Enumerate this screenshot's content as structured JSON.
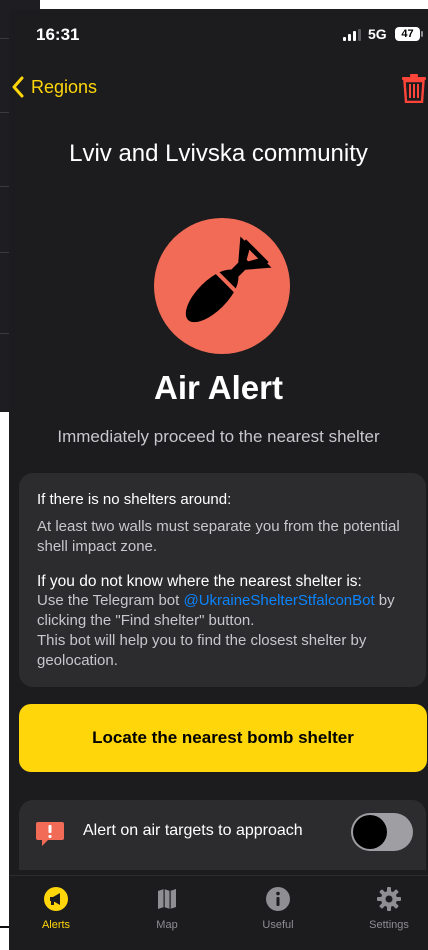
{
  "status": {
    "time": "16:31",
    "network": "5G",
    "battery": "47"
  },
  "nav": {
    "back_label": "Regions",
    "back_icon": "chevron-left-icon",
    "trash_icon": "trash-icon"
  },
  "region": {
    "title": "Lviv and Lvivska community"
  },
  "alert": {
    "icon": "bomb-icon",
    "title": "Air Alert",
    "subtitle": "Immediately proceed to the nearest shelter"
  },
  "info": {
    "no_shelters_heading": "If there is no shelters around:",
    "no_shelters_text": "At least two walls must separate you from the potential shell impact zone.",
    "unknown_heading": "If you do not know where the nearest shelter is:",
    "unknown_text_pre": "Use the Telegram bot ",
    "bot_name": "@UkraineShelterStfalconBot",
    "unknown_text_post": " by clicking the \"Find shelter\" button.",
    "unknown_text_2": "This bot will help you to find the closest shelter by geolocation."
  },
  "locate_button": {
    "label": "Locate the nearest bomb shelter"
  },
  "air_targets": {
    "label": "Alert on air targets to approach",
    "icon": "exclamation-icon",
    "enabled": false
  },
  "tabs": [
    {
      "label": "Alerts",
      "icon": "megaphone-icon",
      "active": true
    },
    {
      "label": "Map",
      "icon": "map-icon",
      "active": false
    },
    {
      "label": "Useful",
      "icon": "info-icon",
      "active": false
    },
    {
      "label": "Settings",
      "icon": "gear-icon",
      "active": false
    }
  ],
  "colors": {
    "accent": "#ffd60a",
    "alert_circle": "#f26b57",
    "trash": "#ff453a",
    "link": "#0a84ff",
    "background": "#1c1c1e",
    "card": "#2c2c2e"
  }
}
